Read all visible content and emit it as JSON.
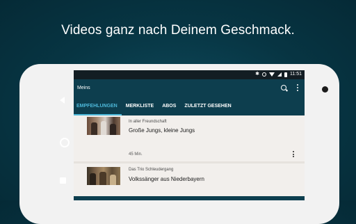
{
  "headline": "Videos ganz nach Deinem Geschmack.",
  "status_bar": {
    "time": "11:51"
  },
  "toolbar": {
    "title": "Meins",
    "search_icon": "search-icon",
    "menu_icon": "overflow-menu-icon"
  },
  "tabs": [
    {
      "label": "EMPFEHLUNGEN",
      "active": true
    },
    {
      "label": "MERKLISTE",
      "active": false
    },
    {
      "label": "ABOS",
      "active": false
    },
    {
      "label": "ZULETZT GESEHEN",
      "active": false
    }
  ],
  "videos": [
    {
      "channel": "In aller Freundschaft",
      "title": "Große Jungs, kleine Jungs",
      "duration": "45 Min."
    },
    {
      "channel": "Das Trio Schleudergang",
      "title": "Volkssänger aus Niederbayern"
    }
  ],
  "colors": {
    "toolbar": "#0d3e4e",
    "accent": "#4db8d9",
    "background": "#073543"
  }
}
